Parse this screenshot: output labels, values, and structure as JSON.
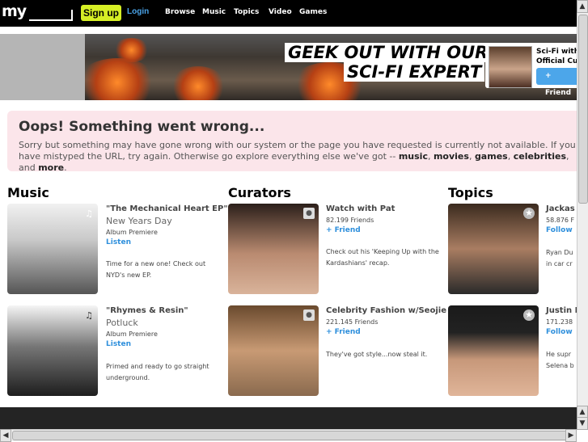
{
  "header": {
    "logo": "my",
    "signup_label": "Sign up",
    "login_label": "Login",
    "nav": [
      "Browse",
      "Music",
      "Topics",
      "Video",
      "Games"
    ]
  },
  "banner": {
    "headline_line1": "GEEK OUT WITH OUR",
    "headline_line2": "SCI-FI EXPERT",
    "promo_text": "Sci-Fi with\nOfficial Cur",
    "friend_button": "+ Friend"
  },
  "error": {
    "title": "Oops! Something went wrong...",
    "text_before": "Sorry but something may have gone wrong with our system or the page you have requested is currently not available. If you have mistyped the URL, try again. Otherwise go explore everything else we've got -- ",
    "links": [
      "music",
      "movies",
      "games",
      "celebrities"
    ],
    "text_and": ", and ",
    "more_link": "more",
    "text_end": "."
  },
  "sections": {
    "music": {
      "title": "Music",
      "items": [
        {
          "title": "\"The Mechanical Heart EP\"",
          "subtitle": "New Years Day",
          "meta": "Album Premiere",
          "link": "Listen",
          "desc": "Time for a new one! Check out NYD's new EP."
        },
        {
          "title": "\"Rhymes & Resin\"",
          "subtitle": "Potluck",
          "meta": "Album Premiere",
          "link": "Listen",
          "desc": "Primed and ready to go straight underground."
        }
      ]
    },
    "curators": {
      "title": "Curators",
      "items": [
        {
          "title": "Watch with Pat",
          "meta": "82.199 Friends",
          "link": "+ Friend",
          "desc": "Check out his 'Keeping Up with the Kardashians' recap."
        },
        {
          "title": "Celebrity Fashion w/Seojie",
          "meta": "221.145 Friends",
          "link": "+ Friend",
          "desc": "They've got style...now steal it."
        }
      ]
    },
    "topics": {
      "title": "Topics",
      "items": [
        {
          "title": "Jackas",
          "meta": "58.876 F",
          "link": "Follow",
          "desc": "Ryan Du\nin car cr"
        },
        {
          "title": "Justin I",
          "meta": "171.238",
          "link": "Follow",
          "desc": "He supr\nSelena b"
        }
      ]
    }
  },
  "icons": {
    "music_note": "♫",
    "person": "person-icon",
    "star": "★",
    "up": "▲",
    "down": "▼",
    "left": "◀",
    "right": "▶"
  },
  "colors": {
    "signup_bg": "#d6ef25",
    "link_blue": "#2e8fdc",
    "error_bg": "#fbe5ea",
    "topbar": "#000000"
  }
}
